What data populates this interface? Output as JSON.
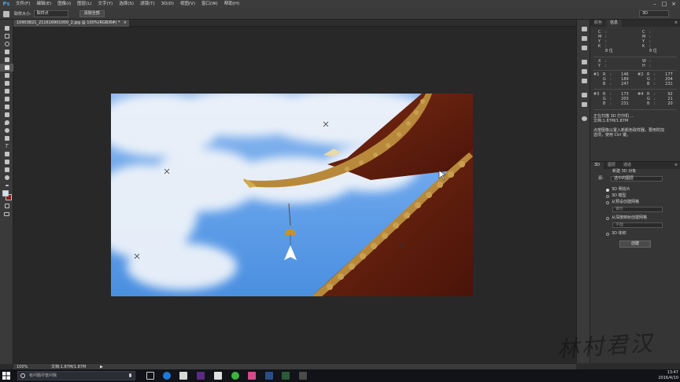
{
  "app": {
    "logo": "Ps"
  },
  "menu": [
    "文件(F)",
    "编辑(E)",
    "图像(I)",
    "图层(L)",
    "文字(Y)",
    "选择(S)",
    "滤镜(T)",
    "3D(D)",
    "视图(V)",
    "窗口(W)",
    "帮助(H)"
  ],
  "window_controls": [
    "–",
    "□",
    "×"
  ],
  "options_bar": {
    "sample_size_label": "取样大小:",
    "sample_size_value": "取样点",
    "clear_all_label": "清除全部",
    "workspace_value": "3D"
  },
  "document_tab": {
    "title": "10903821_211616901000_2.jpg @ 100%(RGB/8#) *",
    "close": "×"
  },
  "status_bar": {
    "zoom": "100%",
    "doc_size": "文档:1.87M/1.87M",
    "arrow": "▶"
  },
  "info_panel": {
    "tabs": [
      "颜色",
      "信息"
    ],
    "active_tab": "信息",
    "block1": [
      [
        "C",
        ":"
      ],
      [
        "M",
        ":"
      ],
      [
        "Y",
        ":"
      ],
      [
        "K",
        ":"
      ],
      [
        "",
        "8 位"
      ]
    ],
    "block2": [
      [
        "C",
        ":"
      ],
      [
        "M",
        ":"
      ],
      [
        "Y",
        ":"
      ],
      [
        "K",
        ":"
      ],
      [
        "",
        "8 位"
      ]
    ],
    "xy1": [
      [
        "X",
        ":"
      ],
      [
        "Y",
        ":"
      ]
    ],
    "wh1": [
      [
        "W",
        ":"
      ],
      [
        "H",
        ":"
      ]
    ],
    "sample1": {
      "label": "#1",
      "R": "146",
      "G": "189",
      "B": "247"
    },
    "sample2": {
      "label": "#2",
      "R": "177",
      "G": "204",
      "B": "231"
    },
    "sample3": {
      "label": "#3",
      "R": "173",
      "G": "203",
      "B": "231"
    },
    "sample4": {
      "label": "#4",
      "R": "92",
      "G": "21",
      "B": "20"
    },
    "notes": [
      "正在扫描 3D 打印机 ...",
      "文档:1.87M/1.87M",
      "",
      "点按图像以置入新颜色取样器。要用附加",
      "选项，使用 Ctrl 键。"
    ]
  },
  "panel_3d": {
    "tabs": [
      "3D",
      "图层",
      "通道"
    ],
    "active_tab": "3D",
    "new_object_label": "新建 3D 对象",
    "source_label": "源:",
    "source_value": "选中的图层",
    "options": [
      {
        "label": "3D 明信片",
        "selected": true
      },
      {
        "label": "3D 模型",
        "selected": false
      },
      {
        "label": "从预设创建网格",
        "selected": false
      },
      {
        "label": "从深度映射创建网格",
        "selected": false
      },
      {
        "label": "3D 体积",
        "selected": false
      }
    ],
    "preset_placeholder": "锥形",
    "depth_placeholder": "平面",
    "create_label": "创建"
  },
  "taskbar": {
    "search_placeholder": "有问题尽管问我",
    "time": "13:47",
    "date": "2016/4/10"
  },
  "watermark_text": "林村君汉",
  "colors": {
    "accent_blue": "#3aa0f0",
    "foreground_swatch": "#cfe0f2",
    "background_swatch": "#8a1c16"
  }
}
